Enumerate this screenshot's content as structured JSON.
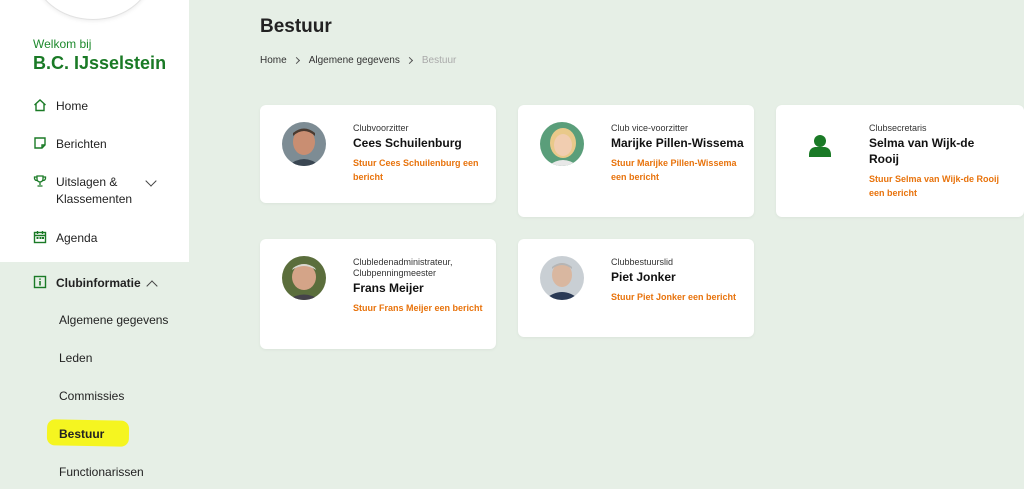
{
  "sidebar": {
    "welcome": "Welkom bij",
    "club_name": "B.C. IJsselstein",
    "nav": [
      {
        "label": "Home",
        "icon": "home-icon"
      },
      {
        "label": "Berichten",
        "icon": "message-icon"
      },
      {
        "label": "Uitslagen & Klassementen",
        "icon": "trophy-icon"
      },
      {
        "label": "Agenda",
        "icon": "calendar-icon"
      }
    ],
    "section": {
      "label": "Clubinformatie",
      "icon": "info-icon"
    },
    "sub_items": [
      {
        "label": "Algemene gegevens"
      },
      {
        "label": "Leden"
      },
      {
        "label": "Commissies"
      },
      {
        "label": "Bestuur"
      },
      {
        "label": "Functionarissen"
      }
    ]
  },
  "main": {
    "title": "Bestuur",
    "breadcrumb": [
      "Home",
      "Algemene gegevens",
      "Bestuur"
    ],
    "members": [
      {
        "role": "Clubvoorzitter",
        "name": "Cees Schuilenburg",
        "message": "Stuur Cees Schuilenburg een bericht"
      },
      {
        "role": "Club vice-voorzitter",
        "name": "Marijke Pillen-Wissema",
        "message": "Stuur Marijke Pillen-Wissema een bericht"
      },
      {
        "role": "Clubsecretaris",
        "name": "Selma van Wijk-de Rooij",
        "message": "Stuur Selma van Wijk-de Rooij een bericht"
      },
      {
        "role": "Clubledenadministrateur, Clubpenningmeester",
        "name": "Frans Meijer",
        "message": "Stuur Frans Meijer een bericht"
      },
      {
        "role": "Clubbestuurslid",
        "name": "Piet Jonker",
        "message": "Stuur Piet Jonker een bericht"
      }
    ]
  },
  "colors": {
    "brand_green": "#1a7a26",
    "accent_orange": "#e8730c",
    "background": "#e6efe6",
    "highlight": "#f5f520"
  }
}
